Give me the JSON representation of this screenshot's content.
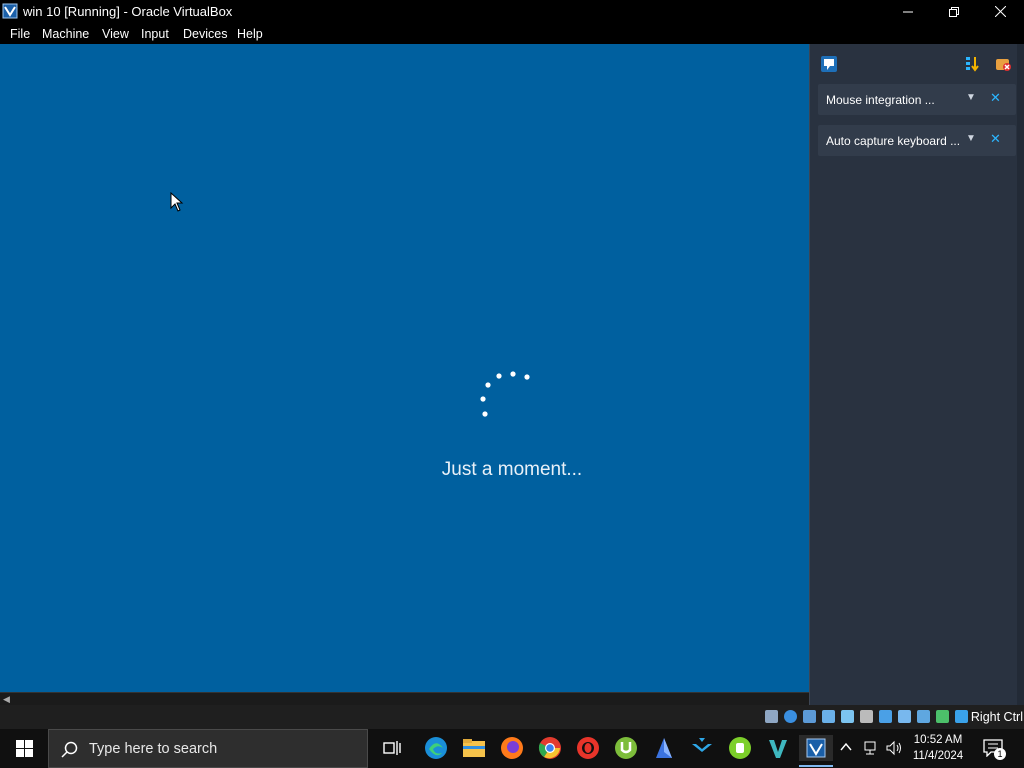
{
  "window": {
    "title": "win 10 [Running] - Oracle VirtualBox",
    "controls": [
      "minimize-icon",
      "restore-icon",
      "close-icon"
    ]
  },
  "menu": {
    "items": [
      "File",
      "Machine",
      "View",
      "Input",
      "Devices",
      "Help"
    ]
  },
  "vm_screen": {
    "background": "#00609f",
    "message": "Just a moment..."
  },
  "notifications": {
    "items": [
      {
        "text": "Mouse integration ..."
      },
      {
        "text": "Auto capture keyboard ..."
      }
    ]
  },
  "statusbar": {
    "host_key": "Right Ctrl",
    "icons": [
      "hard-disk-icon",
      "optical-drive-icon",
      "audio-icon",
      "network-icon",
      "usb-icon",
      "shared-folders-icon",
      "display-icon",
      "recording-icon",
      "cpu-icon",
      "mouse-integration-icon",
      "keyboard-capture-icon"
    ]
  },
  "taskbar": {
    "search_placeholder": "Type here to search",
    "apps": [
      "task-view-icon",
      "edge-icon",
      "file-explorer-icon",
      "firefox-icon",
      "chrome-icon",
      "opera-icon",
      "utorrent-icon",
      "app-blue-icon",
      "app-arrows-icon",
      "app-green-icon",
      "visual-studio-icon",
      "virtualbox-icon"
    ],
    "time": "10:52 AM",
    "date": "11/4/2024",
    "notification_count": "1"
  },
  "colors": {
    "accent": "#2bb6ff",
    "vm_bg": "#00609f",
    "panel_bg": "#293240"
  }
}
